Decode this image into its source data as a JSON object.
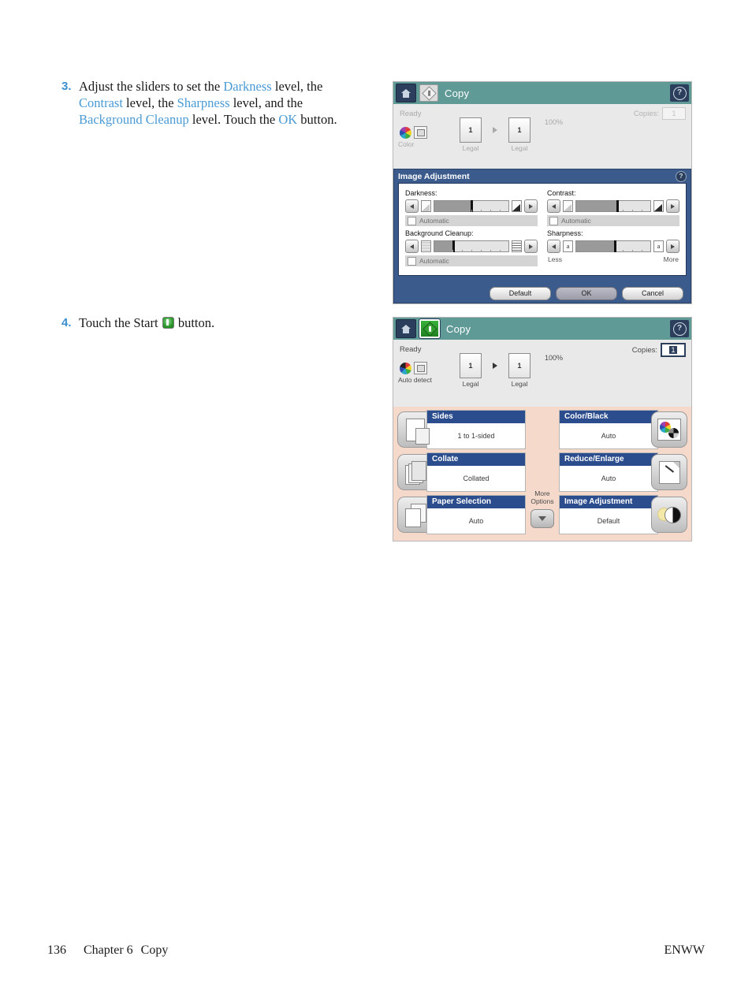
{
  "steps": [
    {
      "number": "3.",
      "segments": [
        {
          "text": "Adjust the sliders to set the ",
          "hl": false
        },
        {
          "text": "Darkness",
          "hl": true
        },
        {
          "text": " level, the ",
          "hl": false
        },
        {
          "text": "Contrast",
          "hl": true
        },
        {
          "text": " level, the ",
          "hl": false
        },
        {
          "text": "Sharpness",
          "hl": true
        },
        {
          "text": " level, and the ",
          "hl": false
        },
        {
          "text": "Background Cleanup",
          "hl": true
        },
        {
          "text": " level. Touch the ",
          "hl": false
        },
        {
          "text": "OK",
          "hl": true
        },
        {
          "text": " button.",
          "hl": false
        }
      ]
    },
    {
      "number": "4.",
      "prefix": "Touch the Start ",
      "icon": "start-icon",
      "suffix": " button."
    }
  ],
  "screen1": {
    "topbar": {
      "home_icon": "home-icon",
      "start_icon": "start-icon",
      "title": "Copy",
      "help_icon": "help-icon",
      "help_glyph": "?"
    },
    "status": {
      "ready": "Ready",
      "copies_label": "Copies:",
      "copies_value": "1",
      "mode_label": "Color",
      "mode_icon": "color-wheel-icon",
      "scan_icon": "scan-source-icon",
      "zoom_percent": "100%",
      "preview_from": {
        "page": "1",
        "size": "Legal"
      },
      "preview_to": {
        "page": "1",
        "size": "Legal"
      }
    },
    "dialog": {
      "title": "Image Adjustment",
      "help_glyph": "?",
      "controls": [
        {
          "label": "Darkness:",
          "left_icon": "darkness-low-icon",
          "right_icon": "darkness-high-icon",
          "thumb_percent": 50,
          "fill_percent": 50,
          "auto_label": "Automatic",
          "auto_checked": false
        },
        {
          "label": "Contrast:",
          "left_icon": "contrast-low-icon",
          "right_icon": "contrast-high-icon",
          "thumb_percent": 55,
          "fill_percent": 55,
          "auto_label": "Automatic",
          "auto_checked": false
        },
        {
          "label": "Background Cleanup:",
          "left_icon": "background-low-icon",
          "right_icon": "background-high-icon",
          "thumb_percent": 25,
          "fill_percent": 25,
          "auto_label": "Automatic",
          "auto_checked": false
        },
        {
          "label": "Sharpness:",
          "left_icon": "sharpness-low-icon",
          "right_icon": "sharpness-high-icon",
          "left_glyph": "a",
          "right_glyph": "a",
          "thumb_percent": 52,
          "fill_percent": 52,
          "less_label": "Less",
          "more_label": "More"
        }
      ],
      "buttons": [
        {
          "label": "Default",
          "primary": false
        },
        {
          "label": "OK",
          "primary": true
        },
        {
          "label": "Cancel",
          "primary": false
        }
      ]
    }
  },
  "screen2": {
    "topbar": {
      "home_icon": "home-icon",
      "start_icon": "start-icon",
      "title": "Copy",
      "help_icon": "help-icon",
      "help_glyph": "?"
    },
    "status": {
      "ready": "Ready",
      "copies_label": "Copies:",
      "copies_value": "1",
      "mode_label": "Auto detect",
      "mode_icon": "color-wheel-icon",
      "scan_icon": "scan-source-icon",
      "zoom_percent": "100%",
      "preview_from": {
        "page": "1",
        "size": "Legal"
      },
      "preview_to": {
        "page": "1",
        "size": "Legal"
      }
    },
    "tiles_left": [
      {
        "title": "Sides",
        "value": "1 to 1-sided",
        "icon": "sides-icon"
      },
      {
        "title": "Collate",
        "value": "Collated",
        "icon": "collate-icon"
      },
      {
        "title": "Paper Selection",
        "value": "Auto",
        "icon": "paper-selection-icon"
      }
    ],
    "tiles_right": [
      {
        "title": "Color/Black",
        "value": "Auto",
        "icon": "color-black-icon"
      },
      {
        "title": "Reduce/Enlarge",
        "value": "Auto",
        "icon": "reduce-enlarge-icon"
      },
      {
        "title": "Image Adjustment",
        "value": "Default",
        "icon": "image-adjustment-icon"
      }
    ],
    "more_options": {
      "line1": "More",
      "line2": "Options",
      "chevron_icon": "chevron-down-icon"
    }
  },
  "footer": {
    "page_number": "136",
    "chapter": "Chapter 6",
    "section": "Copy",
    "locale": "ENWW"
  },
  "colors": {
    "accent_link": "#4a9ad4",
    "topbar_teal": "#5f9a97",
    "navy": "#2b3f5c",
    "dialog_blue": "#3a5b8c",
    "tile_header": "#2b4d8e",
    "tiles_bg": "#f5d9cb"
  }
}
